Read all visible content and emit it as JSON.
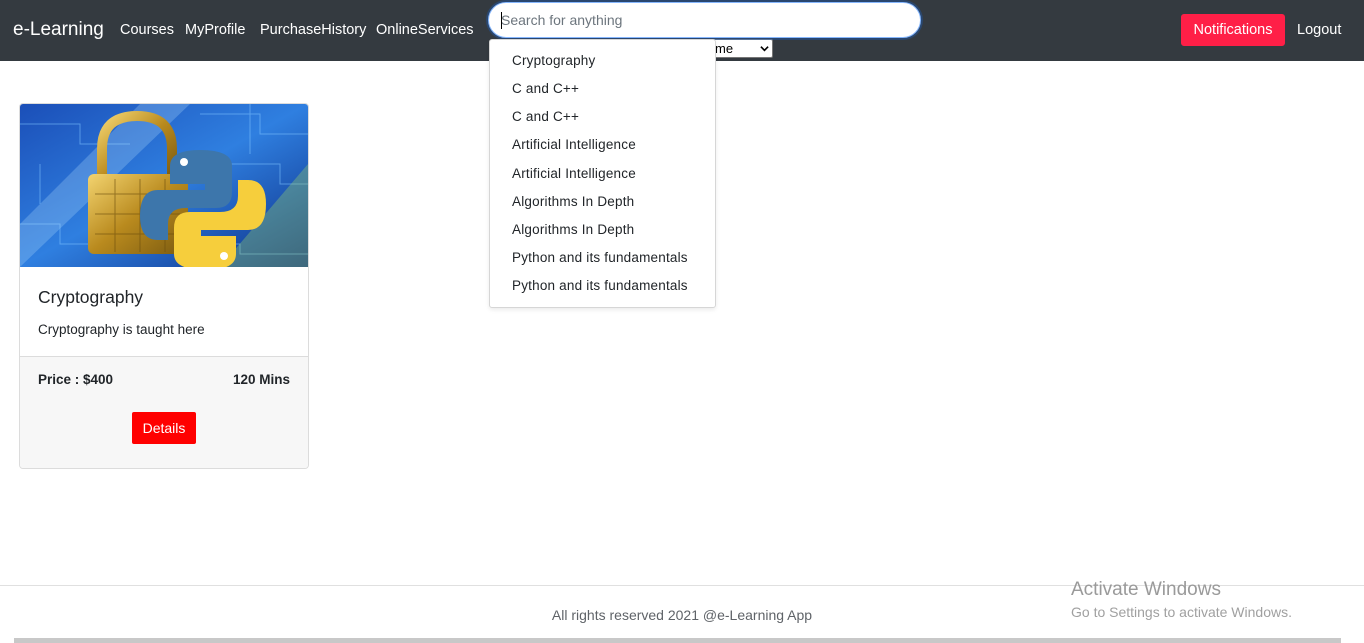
{
  "navbar": {
    "brand": "e-Learning",
    "links": [
      "Courses",
      "MyProfile",
      "PurchaseHistory",
      "OnlineServices"
    ],
    "notifications_label": "Notifications",
    "logout_label": "Logout",
    "colors": {
      "background": "#343a40",
      "notifications": "#ff1f47"
    }
  },
  "search": {
    "placeholder": "Search for anything",
    "value": ""
  },
  "sort_select": {
    "visible_text": "me"
  },
  "dropdown": {
    "suggestions": [
      "Cryptography",
      "C and C++",
      "C and C++",
      "Artificial Intelligence",
      "Artificial Intelligence",
      "Algorithms In Depth",
      "Algorithms In Depth",
      "Python and its fundamentals",
      "Python and its fundamentals"
    ]
  },
  "course_card": {
    "image_icon": "padlock-python-logo-image",
    "title": "Cryptography",
    "description": "Cryptography is taught here",
    "price": "Price : $400",
    "duration": "120 Mins",
    "details_label": "Details",
    "colors": {
      "details_button": "#ff0000"
    }
  },
  "footer": {
    "text": "All rights reserved 2021 @e-Learning App"
  },
  "watermark": {
    "title": "Activate Windows",
    "subtitle": "Go to Settings to activate Windows."
  }
}
